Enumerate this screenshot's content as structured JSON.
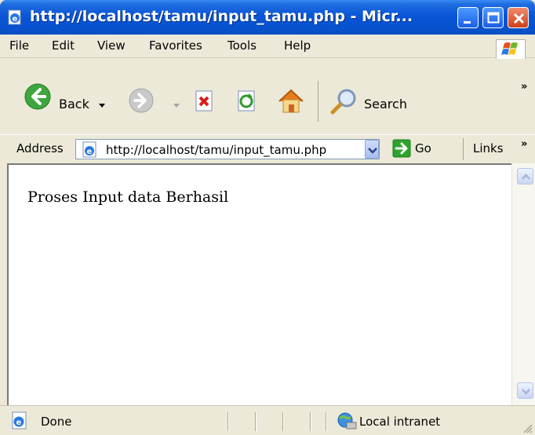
{
  "window": {
    "title": "http://localhost/tamu/input_tamu.php - Micr...",
    "title_color": "#0a55d6"
  },
  "menu": {
    "items": [
      "File",
      "Edit",
      "View",
      "Favorites",
      "Tools",
      "Help"
    ]
  },
  "toolbar": {
    "back_label": "Back",
    "search_label": "Search",
    "overflow_glyph": "»"
  },
  "address_bar": {
    "label": "Address",
    "url": "http://localhost/tamu/input_tamu.php",
    "go_label": "Go",
    "links_label": "Links",
    "overflow_glyph": "»"
  },
  "page": {
    "message": "Proses Input data Berhasil"
  },
  "status_bar": {
    "status": "Done",
    "zone": "Local intranet"
  },
  "colors": {
    "accent": "#0a55d6",
    "close_button": "#d0401a",
    "go_green": "#2ea32e"
  }
}
